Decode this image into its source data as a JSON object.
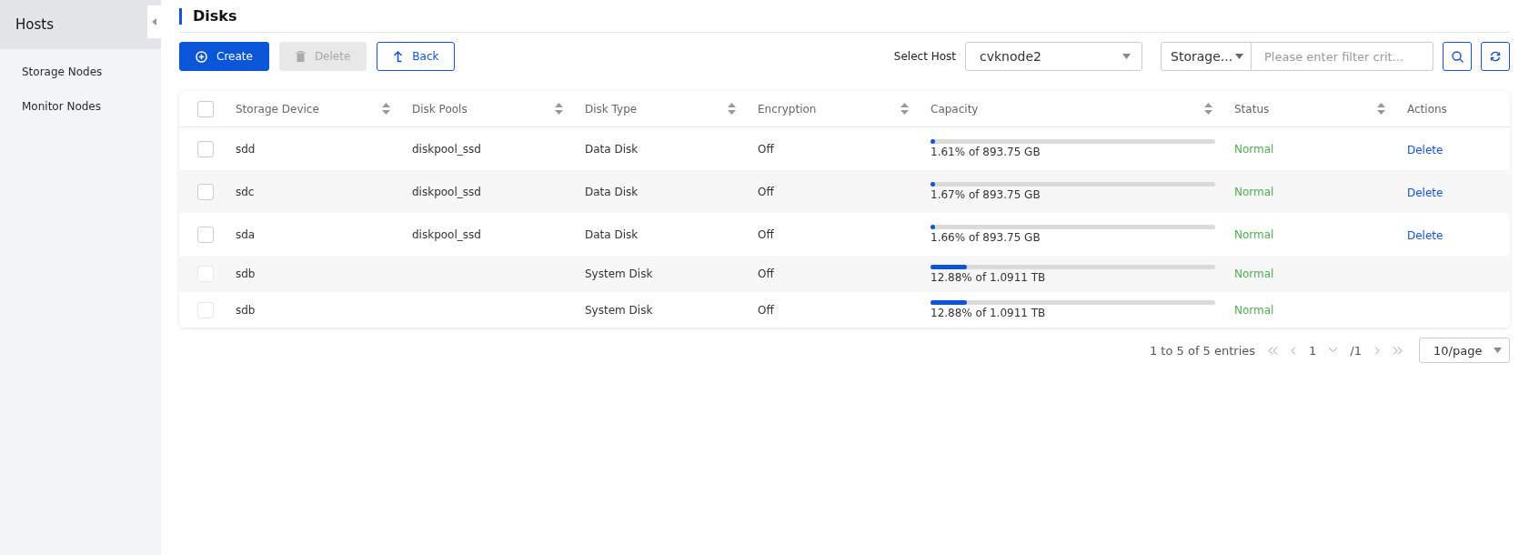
{
  "sidebar": {
    "items": [
      {
        "label": "Hosts",
        "selected": true
      },
      {
        "label": "Storage Nodes",
        "selected": false
      },
      {
        "label": "Monitor Nodes",
        "selected": false
      }
    ]
  },
  "page_title": "Disks",
  "toolbar": {
    "buttons": [
      {
        "kind": "create",
        "label": "Create",
        "disabled": false
      },
      {
        "kind": "delete",
        "label": "Delete",
        "disabled": true
      },
      {
        "kind": "back",
        "label": "Back",
        "disabled": false
      }
    ],
    "host_label": "Select Host",
    "host_value": "cvknode2",
    "filter_field": "Storage...",
    "filter_placeholder": "Please enter filter crit..."
  },
  "table": {
    "select_all_checked": false,
    "columns": [
      {
        "label": "Storage Device",
        "sortable": true
      },
      {
        "label": "Disk Pools",
        "sortable": true
      },
      {
        "label": "Disk Type",
        "sortable": true
      },
      {
        "label": "Encryption",
        "sortable": true
      },
      {
        "label": "Capacity",
        "sortable": true
      },
      {
        "label": "Status",
        "sortable": true
      },
      {
        "label": "Actions",
        "sortable": false
      }
    ],
    "rows": [
      {
        "checkbox_disabled": false,
        "device": "sdd",
        "pool": "diskpool_ssd",
        "type": "Data Disk",
        "encryption": "Off",
        "level": 0.0161,
        "capacity": "1.61% of 893.75 GB",
        "status": "Normal",
        "action": "Delete"
      },
      {
        "checkbox_disabled": false,
        "device": "sdc",
        "pool": "diskpool_ssd",
        "type": "Data Disk",
        "encryption": "Off",
        "level": 0.0167,
        "capacity": "1.67% of 893.75 GB",
        "status": "Normal",
        "action": "Delete"
      },
      {
        "checkbox_disabled": false,
        "device": "sda",
        "pool": "diskpool_ssd",
        "type": "Data Disk",
        "encryption": "Off",
        "level": 0.0166,
        "capacity": "1.66% of 893.75 GB",
        "status": "Normal",
        "action": "Delete"
      },
      {
        "checkbox_disabled": true,
        "device": "sdb",
        "type": "System Disk",
        "encryption": "Off",
        "level": 0.1288,
        "capacity": "12.88% of 1.0911 TB",
        "status": "Normal"
      },
      {
        "checkbox_disabled": true,
        "device": "sdb",
        "type": "System Disk",
        "encryption": "Off",
        "level": 0.1288,
        "capacity": "12.88% of 1.0911 TB",
        "status": "Normal"
      }
    ]
  },
  "pagination": {
    "summary": "1 to 5 of 5 entries",
    "page": "1",
    "total": "/1",
    "page_size": "10/page"
  }
}
